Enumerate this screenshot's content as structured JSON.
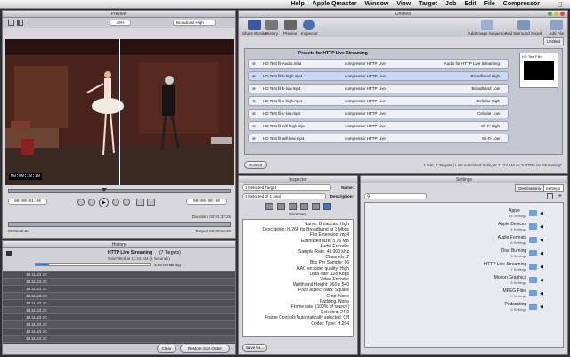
{
  "menubar": {
    "apple": "",
    "items": [
      "Compressor",
      "File",
      "Edit",
      "Job",
      "Target",
      "View",
      "Window",
      "Apple Qmaster",
      "Help"
    ],
    "clock": ""
  },
  "preview": {
    "title": "Preview",
    "zoom": "40%",
    "preset": "Broadcast High",
    "timecode_overlay": "00:00:19:10",
    "in_timecode": "-00:00:19:10",
    "out_timecode": "00:00:01:00",
    "duration": "Duration: 00:01:32:25",
    "output": "Output: 00:00:19:10",
    "timeline_in": "00:00:00:00",
    "timeline_out": "00:01:32:25"
  },
  "batch": {
    "title": "Untitled",
    "toolbar": [
      "Add File",
      "Add Surround Sound",
      "Add Image Sequence",
      "Inspector",
      "Preview",
      "History",
      "Share Monitor"
    ],
    "tab": "Untitled",
    "job_header": "Presets for HTTP Live Streaming",
    "job_source": "HD Test Film",
    "rows": [
      {
        "format": "Audio for HTTP Live Streaming",
        "dest": "compressor HTTP Live",
        "file": "HD Test fil-Audio.m4a",
        "selected": false
      },
      {
        "format": "Broadband High",
        "dest": "compressor HTTP Live",
        "file": "HD Test fil-b-high.mp4",
        "selected": true
      },
      {
        "format": "Broadband Low",
        "dest": "compressor HTTP Live",
        "file": "HD Test fil-b-low.mp4",
        "selected": false
      },
      {
        "format": "Cellular High",
        "dest": "compressor HTTP Live",
        "file": "HD Test fil-c-high.mp4",
        "selected": false
      },
      {
        "format": "Cellular Low",
        "dest": "compressor HTTP Live",
        "file": "HD Test fil-c-low.mp4",
        "selected": false
      },
      {
        "format": "Wi-Fi High",
        "dest": "compressor HTTP Live",
        "file": "HD Test fil-wifi-high.mp4",
        "selected": false
      },
      {
        "format": "Wi-Fi Low",
        "dest": "compressor HTTP Live",
        "file": "HD Test fil-wifi-low.mp4",
        "selected": false
      }
    ],
    "status": "1 Job, 7 Targets | Last submitted today at 11:22 AM as \"HTTP Live Streaming\"",
    "submit": "Submit"
  },
  "history": {
    "title": "History",
    "job_name": "HTTP Live Streaming",
    "job_targets": "(7 Targets)",
    "submitted": "Submitted at 11:22 AM (5 seconds)",
    "progress_label": "4:06 remaining",
    "rows": [
      "18.11.23 JC",
      "18.11.23 JC",
      "18.11.23 JC",
      "18.11.23 JC",
      "18.11.23 JC",
      "18.11.23 JC",
      "18.11.23 JC",
      "18.11.23 JC",
      "18.11.23 JC",
      "18.11.23 JC",
      "18.11.23 JC",
      "18.11.23 JC",
      "18.11.23 JC",
      "18.11.23 JC",
      "18.11.23 JC"
    ],
    "clear_btn": "Clear",
    "reorder_btn": "Restore Sort Order"
  },
  "inspector": {
    "title": "Inspector",
    "name_label": "Name:",
    "name_value": "1 Selected Target",
    "desc_label": "Description:",
    "desc_value": "1 Selected of 1 total.",
    "summary_tab": "Summary",
    "lines": [
      "Name: Broadcast High",
      "Description: H.264 for Broadband at 1 Mbps",
      "File Extension: mp4",
      "Estimated size: 5.36 MB",
      "Audio Encoder",
      "Sample Rate: 48.000 kHz",
      "Channels: 2",
      "Bits Per Sample: 16",
      "AAC encoder quality: High",
      "Data rate: 128 Kbps",
      "Video Encoder",
      "Width and Height: 960 x 540",
      "Pixel aspect ratio: Square",
      "Crop: None",
      "Padding: None",
      "Frame rate: (100% of source)",
      "Selected: 24.0",
      "Frame Controls Automatically selected: Off",
      "Codec Type: H.264"
    ],
    "save_as": "Save As..."
  },
  "settings": {
    "title": "Settings",
    "tabs": [
      "Settings",
      "Destinations"
    ],
    "folders": [
      {
        "name": "Apple",
        "sub": "84 Settings"
      },
      {
        "name": "Apple Devices",
        "sub": "4 Settings"
      },
      {
        "name": "Audio Formats",
        "sub": "6 Settings"
      },
      {
        "name": "Disc Burning",
        "sub": "5 Settings"
      },
      {
        "name": "HTTP Live Streaming",
        "sub": "7 Settings"
      },
      {
        "name": "Motion Graphics",
        "sub": "5 Settings"
      },
      {
        "name": "MPEG Files",
        "sub": "9 Settings"
      },
      {
        "name": "Podcasting",
        "sub": "5 Settings"
      }
    ]
  },
  "colors": {
    "accent": "#3b73d6",
    "video_bg": "#1a0b07",
    "stage": "#3a1a18"
  }
}
